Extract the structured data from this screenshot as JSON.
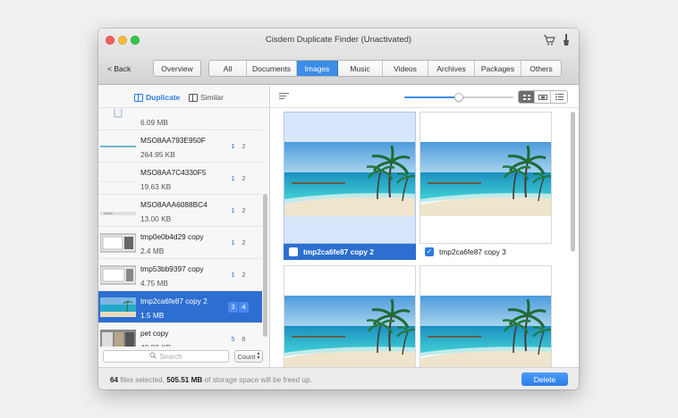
{
  "window": {
    "title": "Cisdem Duplicate Finder (Unactivated)"
  },
  "titlebar_icons": [
    "cart-icon",
    "brush-icon"
  ],
  "toolbar": {
    "back_label": "< Back",
    "overview_label": "Overview",
    "categories": [
      "All",
      "Documents",
      "Images",
      "Music",
      "Videos",
      "Archives",
      "Packages",
      "Others"
    ],
    "active_category": "Images"
  },
  "sidebar": {
    "mode_duplicate": "Duplicate",
    "mode_similar": "Similar",
    "active_mode": "Duplicate",
    "items": [
      {
        "name": "",
        "size": "6.09 MB",
        "counts": [
          "",
          ""
        ],
        "thumb": "doc"
      },
      {
        "name": "MSO8AA793E950F",
        "size": "264.95 KB",
        "counts": [
          "1",
          "2"
        ],
        "thumb": "strip"
      },
      {
        "name": "MSO8AA7C4330F5",
        "size": "19.63 KB",
        "counts": [
          "1",
          "2"
        ],
        "thumb": "blank"
      },
      {
        "name": "MSO8AAA6088BC4",
        "size": "13.00 KB",
        "counts": [
          "1",
          "2"
        ],
        "thumb": "doc"
      },
      {
        "name": "tmp0e0b4d29 copy",
        "size": "2.4 MB",
        "counts": [
          "1",
          "2"
        ],
        "thumb": "screen"
      },
      {
        "name": "tmp53bb9397 copy",
        "size": "4.75 MB",
        "counts": [
          "1",
          "2"
        ],
        "thumb": "screen"
      },
      {
        "name": "tmp2ca6fe87 copy 2",
        "size": "1.5 MB",
        "counts": [
          "3",
          "4"
        ],
        "thumb": "beach",
        "selected": true
      },
      {
        "name": "pet copy",
        "size": "40.88 KB",
        "counts": [
          "5",
          "6"
        ],
        "thumb": "pet"
      }
    ],
    "search_placeholder": "Search",
    "count_label": "Count"
  },
  "main": {
    "slider_value": 0.5,
    "view_modes": [
      "grid-view-icon",
      "filmstrip-view-icon",
      "list-view-icon"
    ],
    "active_view": "grid-view-icon",
    "cards": [
      {
        "label": "tmp2ca6fe87 copy 2",
        "checked": false,
        "selected": true
      },
      {
        "label": "tmp2ca6fe87 copy 3",
        "checked": true,
        "selected": false
      },
      {
        "label": "",
        "checked": false,
        "selected": false
      },
      {
        "label": "",
        "checked": false,
        "selected": false
      }
    ]
  },
  "status": {
    "files_count": "64",
    "files_text": "files selected,",
    "space": "505.51 MB",
    "space_text": "of storage space will be freed up."
  },
  "delete_label": "Delete",
  "colors": {
    "accent": "#2c7be5",
    "selection": "#2c6fd0",
    "active_tab": "#3b8de6"
  }
}
